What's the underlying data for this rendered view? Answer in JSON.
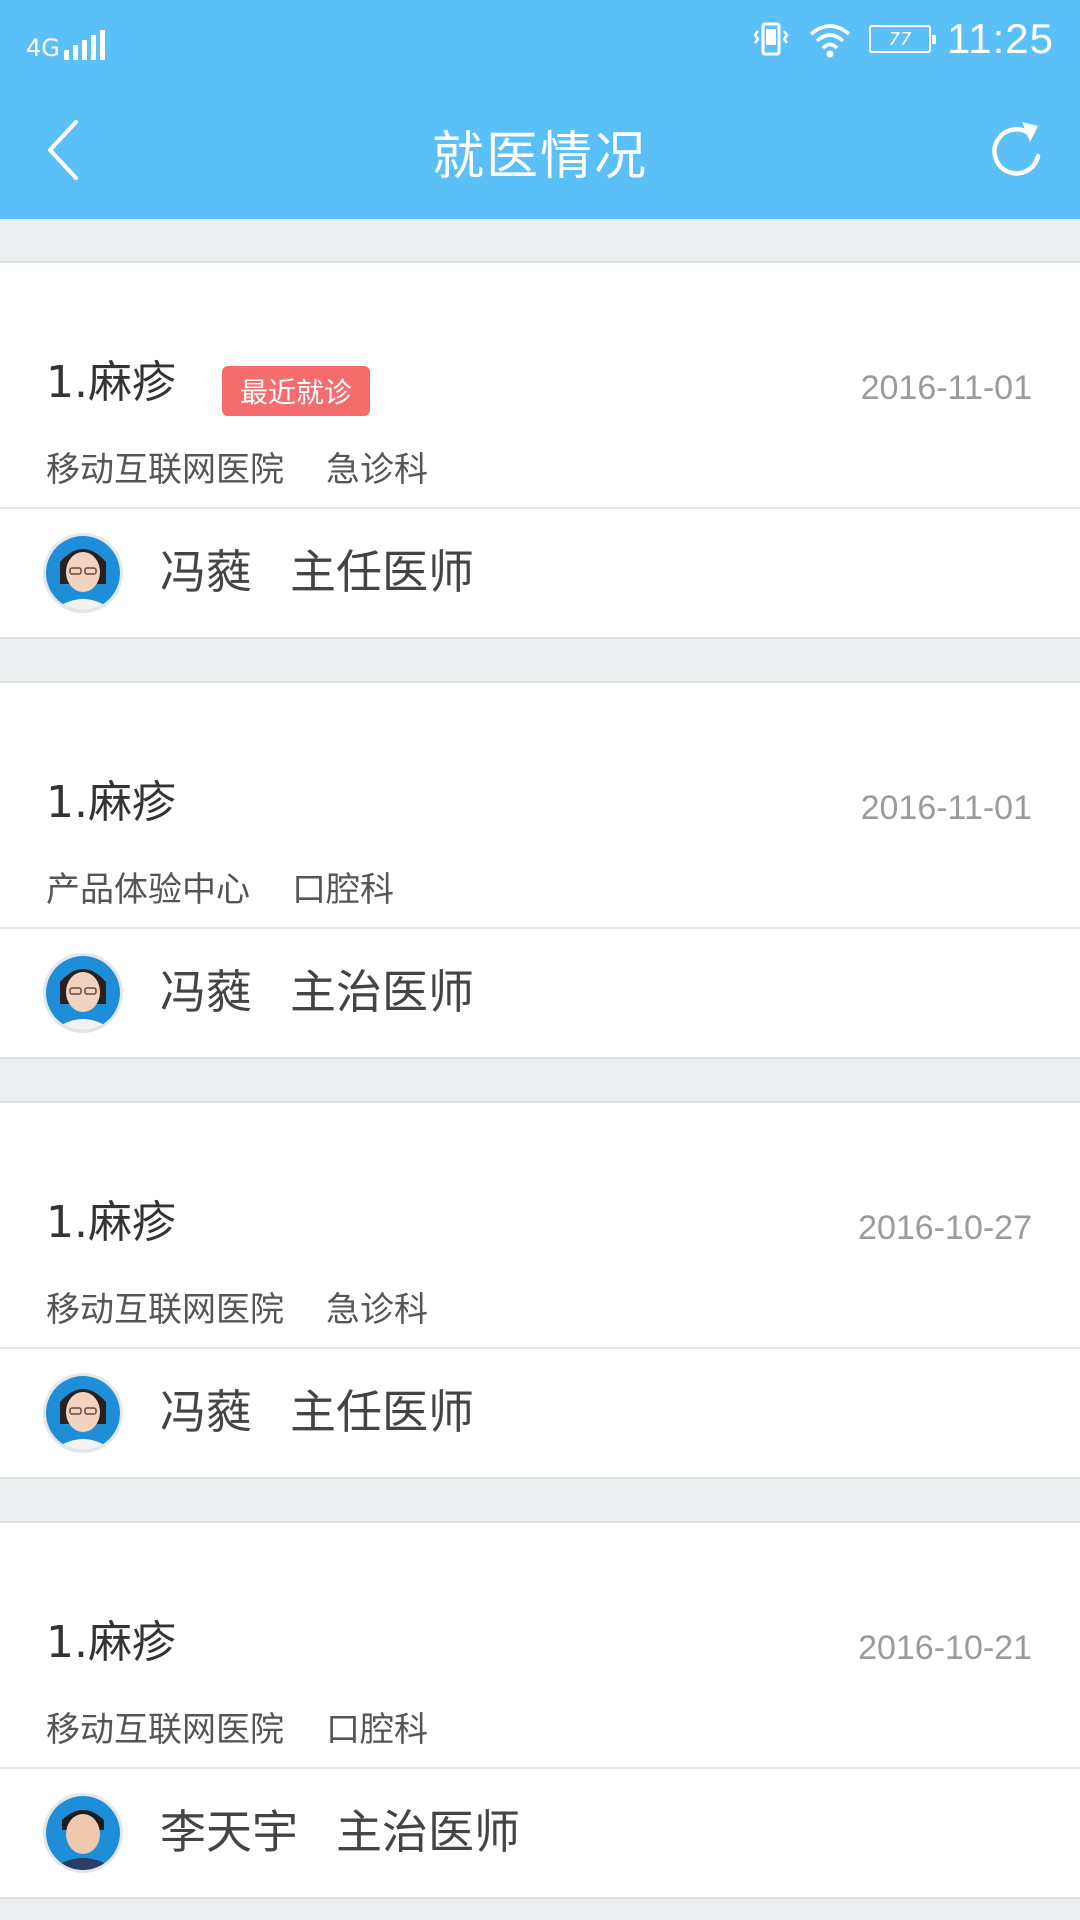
{
  "status_bar": {
    "network": "4G",
    "battery": "77",
    "time": "11:25"
  },
  "nav": {
    "title": "就医情况",
    "back_icon": "chevron-left-icon",
    "refresh_icon": "refresh-icon"
  },
  "records": [
    {
      "diagnosis": "1.麻疹",
      "tag": "最近就诊",
      "date": "2016-11-01",
      "hospital": "移动互联网医院",
      "department": "急诊科",
      "doctor_name": "冯蕤",
      "doctor_title": "主任医师"
    },
    {
      "diagnosis": "1.麻疹",
      "tag": "",
      "date": "2016-11-01",
      "hospital": "产品体验中心",
      "department": "口腔科",
      "doctor_name": "冯蕤",
      "doctor_title": "主治医师"
    },
    {
      "diagnosis": "1.麻疹",
      "tag": "",
      "date": "2016-10-27",
      "hospital": "移动互联网医院",
      "department": "急诊科",
      "doctor_name": "冯蕤",
      "doctor_title": "主任医师"
    },
    {
      "diagnosis": "1.麻疹",
      "tag": "",
      "date": "2016-10-21",
      "hospital": "移动互联网医院",
      "department": "口腔科",
      "doctor_name": "李天宇",
      "doctor_title": "主治医师"
    }
  ],
  "colors": {
    "header": "#5cc0f8",
    "tag": "#f46c6c",
    "background": "#eceff0"
  }
}
